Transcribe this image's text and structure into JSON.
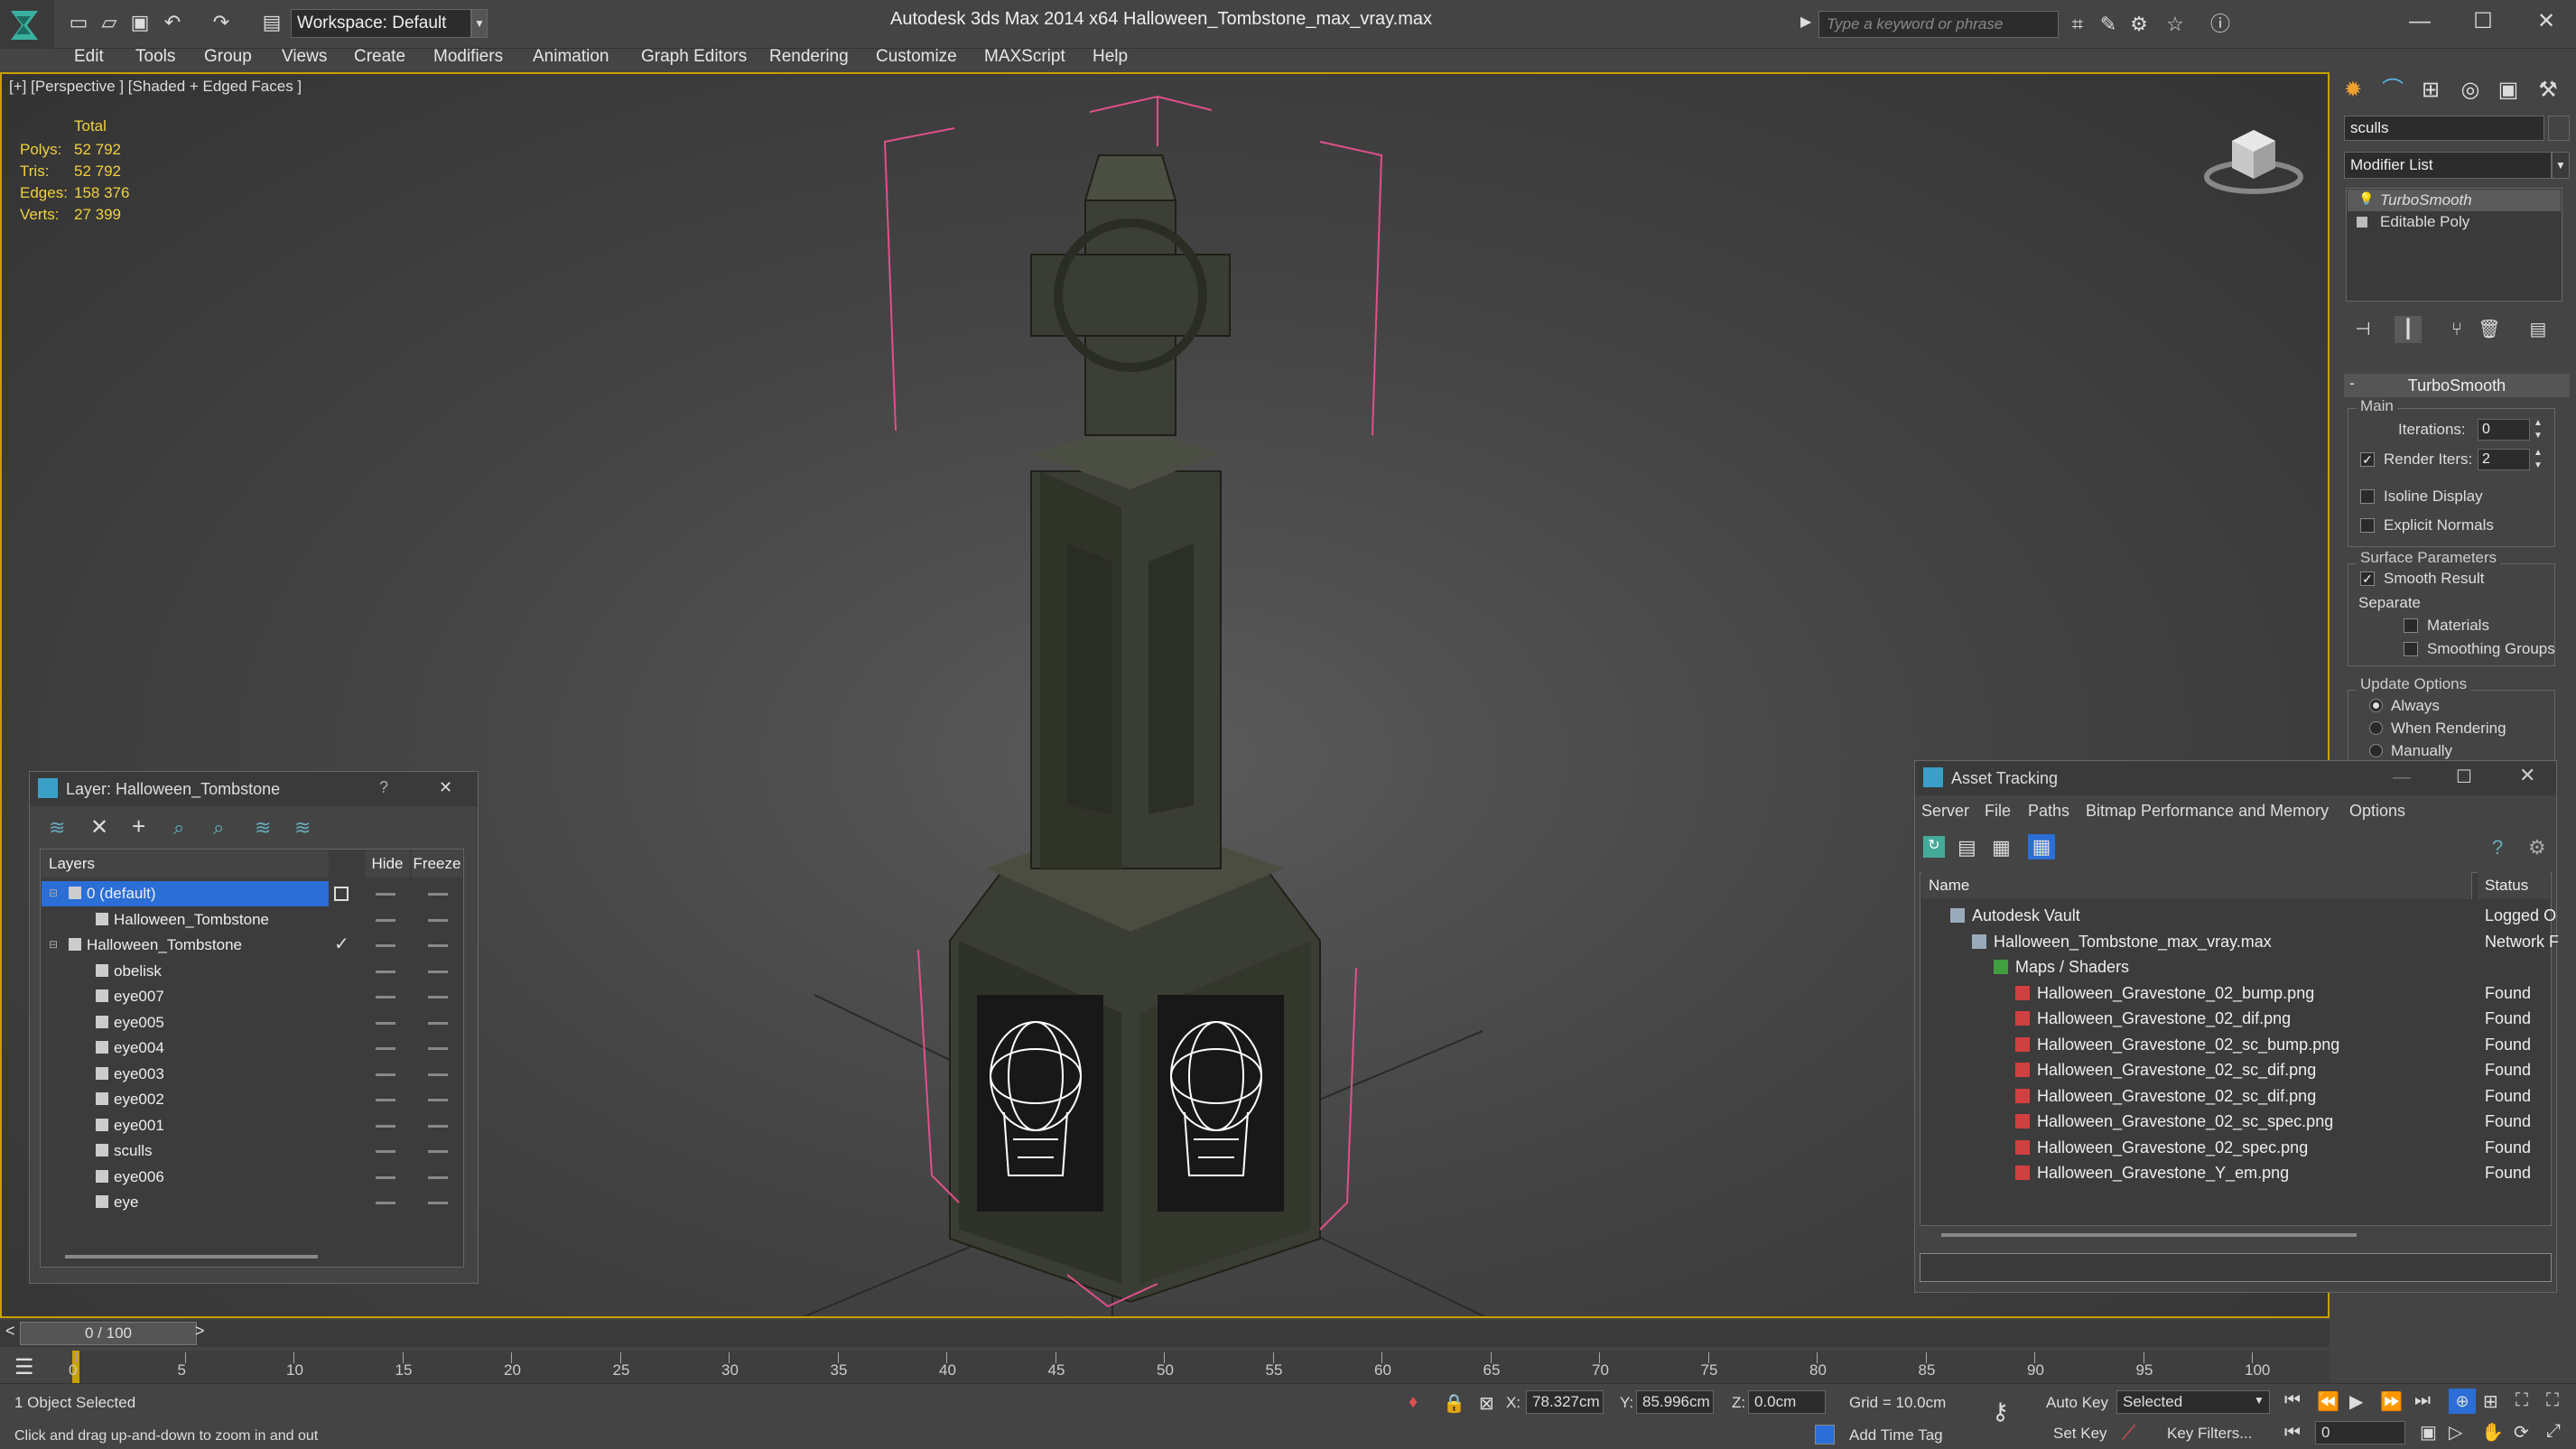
{
  "titlebar": {
    "workspace": "Workspace: Default",
    "app_title": "Autodesk 3ds Max  2014 x64",
    "file_title": "Halloween_Tombstone_max_vray.max",
    "search_placeholder": "Type a keyword or phrase"
  },
  "menu": [
    "Edit",
    "Tools",
    "Group",
    "Views",
    "Create",
    "Modifiers",
    "Animation",
    "Graph Editors",
    "Rendering",
    "Customize",
    "MAXScript",
    "Help"
  ],
  "viewport": {
    "label": "[+] [Perspective ] [Shaded + Edged Faces ]",
    "stats": {
      "header": "Total",
      "polys_label": "Polys:",
      "polys": "52 792",
      "tris_label": "Tris:",
      "tris": "52 792",
      "edges_label": "Edges:",
      "edges": "158 376",
      "verts_label": "Verts:",
      "verts": "27 399"
    }
  },
  "command_panel": {
    "object_name": "sculls",
    "modifier_list": "Modifier List",
    "stack": [
      "TurboSmooth",
      "Editable Poly"
    ],
    "rollout_title": "TurboSmooth",
    "main_group": "Main",
    "iterations_label": "Iterations:",
    "iterations": "0",
    "render_iters_label": "Render Iters:",
    "render_iters": "2",
    "isoline": "Isoline Display",
    "explicit_normals": "Explicit Normals",
    "surface_group": "Surface Parameters",
    "smooth_result": "Smooth Result",
    "separate": "Separate",
    "materials": "Materials",
    "smoothing_groups": "Smoothing Groups",
    "update_group": "Update Options",
    "always": "Always",
    "when_rendering": "When Rendering",
    "manually": "Manually"
  },
  "layer_window": {
    "title": "Layer: Halloween_Tombstone",
    "help": "?",
    "close": "✕",
    "col_layers": "Layers",
    "col_hide": "Hide",
    "col_freeze": "Freeze",
    "rows": [
      {
        "label": "0 (default)",
        "level": 0
      },
      {
        "label": "Halloween_Tombstone",
        "level": 1
      },
      {
        "label": "Halloween_Tombstone",
        "level": 0
      },
      {
        "label": "obelisk",
        "level": 1
      },
      {
        "label": "eye007",
        "level": 1
      },
      {
        "label": "eye005",
        "level": 1
      },
      {
        "label": "eye004",
        "level": 1
      },
      {
        "label": "eye003",
        "level": 1
      },
      {
        "label": "eye002",
        "level": 1
      },
      {
        "label": "eye001",
        "level": 1
      },
      {
        "label": "sculls",
        "level": 1
      },
      {
        "label": "eye006",
        "level": 1
      },
      {
        "label": "eye",
        "level": 1
      }
    ]
  },
  "asset_window": {
    "title": "Asset Tracking",
    "menus": [
      "Server",
      "File",
      "Paths",
      "Bitmap Performance and Memory",
      "Options"
    ],
    "col_name": "Name",
    "col_status": "Status",
    "rows": [
      {
        "name": "Autodesk Vault",
        "status": "Logged O",
        "level": 0
      },
      {
        "name": "Halloween_Tombstone_max_vray.max",
        "status": "Network F",
        "level": 1
      },
      {
        "name": "Maps / Shaders",
        "status": "",
        "level": 2
      },
      {
        "name": "Halloween_Gravestone_02_bump.png",
        "status": "Found",
        "level": 3
      },
      {
        "name": "Halloween_Gravestone_02_dif.png",
        "status": "Found",
        "level": 3
      },
      {
        "name": "Halloween_Gravestone_02_sc_bump.png",
        "status": "Found",
        "level": 3
      },
      {
        "name": "Halloween_Gravestone_02_sc_dif.png",
        "status": "Found",
        "level": 3
      },
      {
        "name": "Halloween_Gravestone_02_sc_dif.png",
        "status": "Found",
        "level": 3
      },
      {
        "name": "Halloween_Gravestone_02_sc_spec.png",
        "status": "Found",
        "level": 3
      },
      {
        "name": "Halloween_Gravestone_02_spec.png",
        "status": "Found",
        "level": 3
      },
      {
        "name": "Halloween_Gravestone_Y_em.png",
        "status": "Found",
        "level": 3
      }
    ]
  },
  "timeline": {
    "frame": "0 / 100",
    "ticks": [
      "0",
      "5",
      "10",
      "15",
      "20",
      "25",
      "30",
      "35",
      "40",
      "45",
      "50",
      "55",
      "60",
      "65",
      "70",
      "75",
      "80",
      "85",
      "90",
      "95",
      "100"
    ]
  },
  "status": {
    "selected": "1 Object Selected",
    "hint": "Click and drag up-and-down to zoom in and out",
    "x_label": "X:",
    "x": "78.327cm",
    "y_label": "Y:",
    "y": "85.996cm",
    "z_label": "Z:",
    "z": "0.0cm",
    "grid": "Grid = 10.0cm",
    "auto_key": "Auto Key",
    "selected_dd": "Selected",
    "set_key": "Set Key",
    "key_filters": "Key Filters...",
    "add_time_tag": "Add Time Tag",
    "frame_field": "0"
  },
  "colors": {
    "accent": "#c8a000",
    "selection": "#2a6ed6",
    "gizmo": "#e0508a",
    "stat": "#f0d040"
  }
}
